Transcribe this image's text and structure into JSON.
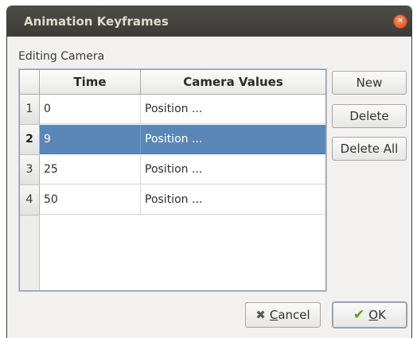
{
  "window": {
    "title": "Animation Keyframes",
    "close_icon": "close-icon"
  },
  "editing_label": "Editing Camera",
  "table": {
    "columns": [
      "Time",
      "Camera Values"
    ],
    "rows": [
      {
        "num": "1",
        "time": "0",
        "values": "Position ..."
      },
      {
        "num": "2",
        "time": "9",
        "values": "Position ...",
        "selected": true
      },
      {
        "num": "3",
        "time": "25",
        "values": "Position ..."
      },
      {
        "num": "4",
        "time": "50",
        "values": "Position ..."
      }
    ]
  },
  "buttons": {
    "new": "New",
    "delete": "Delete",
    "delete_all": "Delete All",
    "cancel_mnemonic": "C",
    "cancel_rest": "ancel",
    "ok_mnemonic": "O",
    "ok_rest": "K"
  },
  "icons": {
    "cancel": "cancel-x-icon",
    "ok": "check-icon"
  },
  "colors": {
    "titlebar": "#3c3b37",
    "selection": "#5b87b7",
    "close": "#e0531f"
  }
}
